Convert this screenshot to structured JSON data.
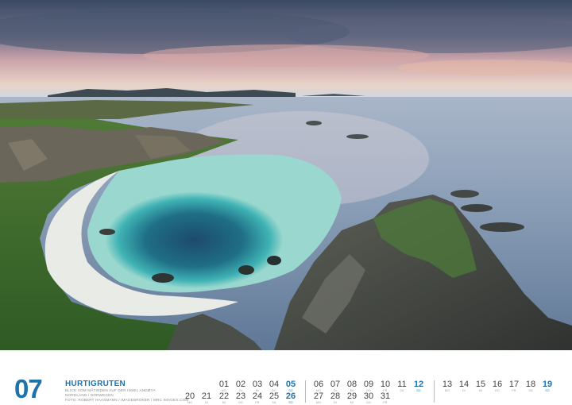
{
  "month": {
    "number": "07",
    "title": "HURTIGRUTEN",
    "lines": [
      "BLICK VOM MÅTINDEN AUF DER INSEL ANDØYA",
      "NORDLAND / NORWEGEN",
      "FOTO: ROBERT HAASMANN / IMAGEBROKER / MRC IMAGES.COM"
    ]
  },
  "calendar": {
    "row1": [
      {
        "n": "01",
        "wd": "MO"
      },
      {
        "n": "02",
        "wd": "DI"
      },
      {
        "n": "03",
        "wd": "MI"
      },
      {
        "n": "04",
        "wd": "DO"
      },
      {
        "n": "05",
        "wd": "SO",
        "sun": true
      },
      {
        "n": "06",
        "wd": "MO"
      },
      {
        "n": "07",
        "wd": "DI"
      },
      {
        "n": "08",
        "wd": "MI"
      },
      {
        "n": "09",
        "wd": "DO"
      },
      {
        "n": "10",
        "wd": "FR"
      },
      {
        "n": "11",
        "wd": "SA"
      },
      {
        "n": "12",
        "wd": "SO",
        "sun": true
      },
      {
        "n": "13",
        "wd": "MO"
      },
      {
        "n": "14",
        "wd": "DI"
      },
      {
        "n": "15",
        "wd": "MI"
      },
      {
        "n": "16",
        "wd": "DO"
      },
      {
        "n": "17",
        "wd": "FR"
      },
      {
        "n": "18",
        "wd": "SA"
      },
      {
        "n": "19",
        "wd": "SO",
        "sun": true
      }
    ],
    "row2": [
      {
        "n": "20",
        "wd": "MO"
      },
      {
        "n": "21",
        "wd": "DI"
      },
      {
        "n": "22",
        "wd": "MI"
      },
      {
        "n": "23",
        "wd": "DO"
      },
      {
        "n": "24",
        "wd": "FR"
      },
      {
        "n": "25",
        "wd": "SA"
      },
      {
        "n": "26",
        "wd": "SO",
        "sun": true
      },
      {
        "n": "27",
        "wd": "MO"
      },
      {
        "n": "28",
        "wd": "DI"
      },
      {
        "n": "29",
        "wd": "MI"
      },
      {
        "n": "30",
        "wd": "DO"
      },
      {
        "n": "31",
        "wd": "FR"
      }
    ]
  },
  "colors": {
    "accent": "#1f73a8"
  }
}
